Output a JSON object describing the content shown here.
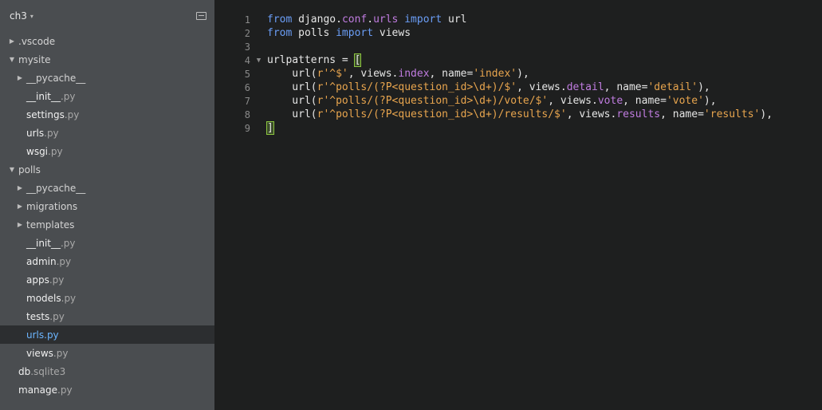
{
  "sidebar": {
    "project": "ch3",
    "tree": [
      {
        "type": "folder",
        "level": 0,
        "expanded": false,
        "name": ".vscode",
        "ext": ""
      },
      {
        "type": "folder",
        "level": 0,
        "expanded": true,
        "name": "mysite",
        "ext": ""
      },
      {
        "type": "folder",
        "level": 1,
        "expanded": false,
        "name": "__pycache__",
        "ext": ""
      },
      {
        "type": "file",
        "level": 1,
        "name": "__init__",
        "ext": ".py"
      },
      {
        "type": "file",
        "level": 1,
        "name": "settings",
        "ext": ".py"
      },
      {
        "type": "file",
        "level": 1,
        "name": "urls",
        "ext": ".py"
      },
      {
        "type": "file",
        "level": 1,
        "name": "wsgi",
        "ext": ".py"
      },
      {
        "type": "folder",
        "level": 0,
        "expanded": true,
        "name": "polls",
        "ext": ""
      },
      {
        "type": "folder",
        "level": 1,
        "expanded": false,
        "name": "__pycache__",
        "ext": ""
      },
      {
        "type": "folder",
        "level": 1,
        "expanded": false,
        "name": "migrations",
        "ext": ""
      },
      {
        "type": "folder",
        "level": 1,
        "expanded": false,
        "name": "templates",
        "ext": ""
      },
      {
        "type": "file",
        "level": 1,
        "name": "__init__",
        "ext": ".py"
      },
      {
        "type": "file",
        "level": 1,
        "name": "admin",
        "ext": ".py"
      },
      {
        "type": "file",
        "level": 1,
        "name": "apps",
        "ext": ".py"
      },
      {
        "type": "file",
        "level": 1,
        "name": "models",
        "ext": ".py"
      },
      {
        "type": "file",
        "level": 1,
        "name": "tests",
        "ext": ".py"
      },
      {
        "type": "file",
        "level": 1,
        "name": "urls",
        "ext": ".py",
        "selected": true
      },
      {
        "type": "file",
        "level": 1,
        "name": "views",
        "ext": ".py"
      },
      {
        "type": "file",
        "level": 0,
        "name": "db",
        "ext": ".sqlite3"
      },
      {
        "type": "file",
        "level": 0,
        "name": "manage",
        "ext": ".py"
      }
    ]
  },
  "editor": {
    "lines": [
      {
        "n": "1",
        "fold": "",
        "tokens": [
          [
            "kw",
            "from"
          ],
          [
            "plain",
            " django."
          ],
          [
            "attr",
            "conf"
          ],
          [
            "plain",
            "."
          ],
          [
            "attr",
            "urls"
          ],
          [
            "plain",
            " "
          ],
          [
            "kw",
            "import"
          ],
          [
            "plain",
            " url"
          ]
        ]
      },
      {
        "n": "2",
        "fold": "",
        "tokens": [
          [
            "kw",
            "from"
          ],
          [
            "plain",
            " polls "
          ],
          [
            "kw",
            "import"
          ],
          [
            "plain",
            " views"
          ]
        ]
      },
      {
        "n": "3",
        "fold": "",
        "tokens": []
      },
      {
        "n": "4",
        "fold": "▼",
        "tokens": [
          [
            "plain",
            "urlpatterns = "
          ],
          [
            "hl",
            "["
          ]
        ]
      },
      {
        "n": "5",
        "fold": "",
        "tokens": [
          [
            "plain",
            "    url("
          ],
          [
            "str",
            "r'^$'"
          ],
          [
            "plain",
            ", views."
          ],
          [
            "attr",
            "index"
          ],
          [
            "plain",
            ", name="
          ],
          [
            "str",
            "'index'"
          ],
          [
            "plain",
            "),"
          ]
        ]
      },
      {
        "n": "6",
        "fold": "",
        "tokens": [
          [
            "plain",
            "    url("
          ],
          [
            "str",
            "r'^polls/(?P<question_id>\\d+)/$'"
          ],
          [
            "plain",
            ", views."
          ],
          [
            "attr",
            "detail"
          ],
          [
            "plain",
            ", name="
          ],
          [
            "str",
            "'detail'"
          ],
          [
            "plain",
            "),"
          ]
        ]
      },
      {
        "n": "7",
        "fold": "",
        "tokens": [
          [
            "plain",
            "    url("
          ],
          [
            "str",
            "r'^polls/(?P<question_id>\\d+)/vote/$'"
          ],
          [
            "plain",
            ", views."
          ],
          [
            "attr",
            "vote"
          ],
          [
            "plain",
            ", name="
          ],
          [
            "str",
            "'vote'"
          ],
          [
            "plain",
            "),"
          ]
        ]
      },
      {
        "n": "8",
        "fold": "",
        "tokens": [
          [
            "plain",
            "    url("
          ],
          [
            "str",
            "r'^polls/(?P<question_id>\\d+)/results/$'"
          ],
          [
            "plain",
            ", views."
          ],
          [
            "attr",
            "results"
          ],
          [
            "plain",
            ", name="
          ],
          [
            "str",
            "'results'"
          ],
          [
            "plain",
            "),"
          ]
        ]
      },
      {
        "n": "9",
        "fold": "",
        "tokens": [
          [
            "hl",
            "]"
          ]
        ]
      }
    ]
  }
}
